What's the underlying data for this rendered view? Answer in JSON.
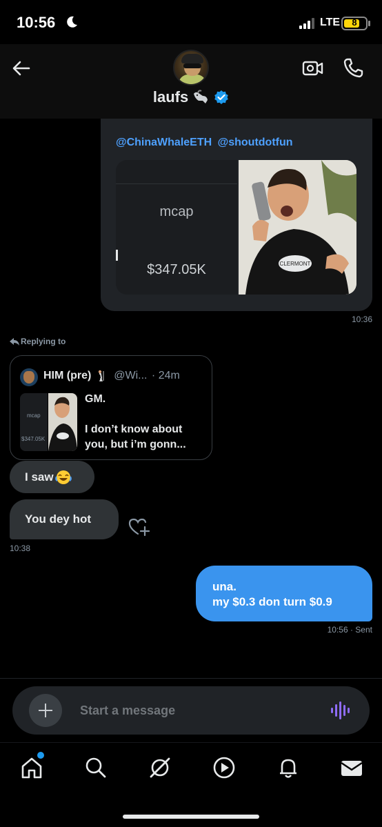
{
  "status_bar": {
    "time": "10:56",
    "network": "LTE",
    "battery": "8"
  },
  "header": {
    "name": "laufs",
    "icons": [
      "back-arrow-icon",
      "video-call-icon",
      "phone-call-icon",
      "verified-badge-icon",
      "goat-emoji-icon"
    ]
  },
  "messages": {
    "card": {
      "mentions": [
        "@ChinaWhaleETH",
        "@shoutdotfun"
      ],
      "image_left_label": "mcap",
      "image_left_value": "$347.05K",
      "time": "10:36"
    },
    "reply": {
      "label": "Replying to",
      "quote_name": "HIM (pre)",
      "quote_handle": "@Wi...",
      "quote_age": "· 24m",
      "quote_line1": "GM.",
      "quote_line2": "I don’t know about you, but i’m gonn...",
      "thumb_label": "mcap",
      "thumb_value": "$347.05K"
    },
    "incoming": [
      {
        "text": "I saw"
      },
      {
        "text": "You dey hot"
      }
    ],
    "incoming_time": "10:38",
    "outgoing": {
      "line1": "una.",
      "line2": "my $0.3 don turn $0.9",
      "meta": "10:56 · Sent"
    }
  },
  "composer": {
    "placeholder": "Start a message"
  },
  "bottom_nav": {
    "items": [
      "home-icon",
      "search-icon",
      "grok-icon",
      "video-icon",
      "notifications-icon",
      "messages-icon"
    ],
    "accent": "#1d9bf0"
  },
  "colors": {
    "accent": "#1d9bf0",
    "outgoing_bubble": "#3a94ee",
    "incoming_bubble": "#2f3336"
  }
}
